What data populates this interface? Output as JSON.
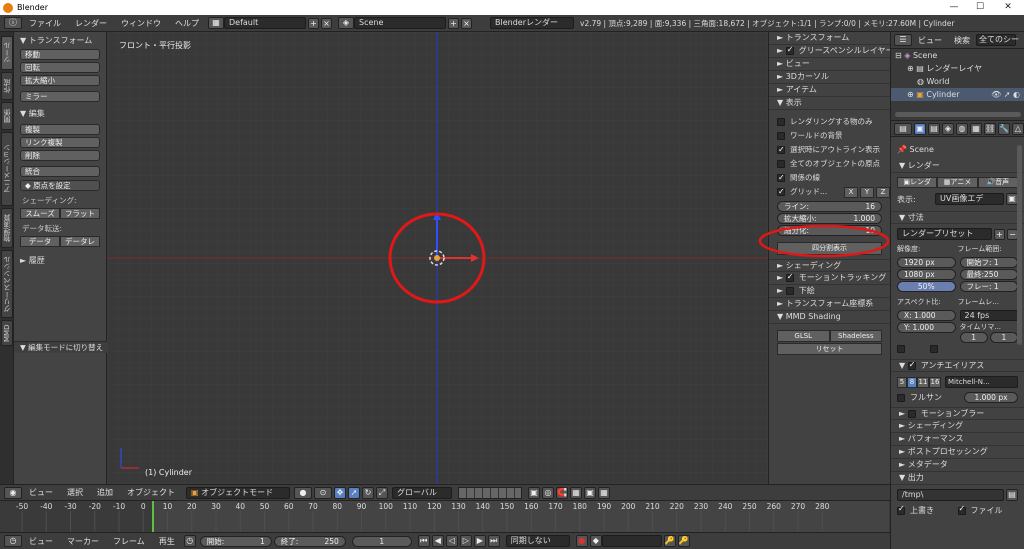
{
  "os_title": "Blender",
  "header": {
    "menus": [
      "ファイル",
      "レンダー",
      "ウィンドウ",
      "ヘルプ"
    ],
    "layout": "Default",
    "scene": "Scene",
    "engine": "Blenderレンダー",
    "stats": "v2.79 | 頂点:9,289 | 面:9,336 | 三角面:18,672 | オブジェクト:1/1 | ランプ:0/0 | メモリ:27.60M | Cylinder"
  },
  "left_tabs": [
    "ツール",
    "作成",
    "関係",
    "アニメーション",
    "物理演算",
    "グリースペンシル",
    "MMD"
  ],
  "toolshelf": {
    "transform_header": "トランスフォーム",
    "move": "移動",
    "rotate": "回転",
    "scale": "拡大縮小",
    "mirror": "ミラー",
    "edit_header": "編集",
    "duplicate": "複製",
    "link_duplicate": "リンク複製",
    "delete": "削除",
    "join": "統合",
    "set_origin": "原点を設定",
    "shading_label": "シェーディング:",
    "smooth": "スムーズ",
    "flat": "フラット",
    "data_transfer_label": "データ転送:",
    "data": "データ",
    "data_layer": "データレ",
    "history": "履歴",
    "edit_mode_toggle": "編集モードに切り替え"
  },
  "viewport": {
    "view_label": "フロント・平行投影",
    "object_label": "(1) Cylinder"
  },
  "npanel": {
    "transform": "トランスフォーム",
    "grease_pencil_layer": "グリースペンシルレイヤー",
    "view": "ビュー",
    "cursor3d": "3Dカーソル",
    "item": "アイテム",
    "display": "表示",
    "only_render": "レンダリングする物のみ",
    "world_bg": "ワールドの背景",
    "outline_selected": "選択時にアウトライン表示",
    "all_origins": "全てのオブジェクトの原点",
    "relationship_lines": "関係の線",
    "grid_floor": "グリッド...",
    "axis_x": "X",
    "axis_y": "Y",
    "axis_z": "Z",
    "lines_label": "ライン:",
    "lines_value": "16",
    "scale_label": "拡大縮小:",
    "scale_value": "1.000",
    "subdiv_label": "細分化:",
    "subdiv_value": "10",
    "quad_view": "四分割表示",
    "shading": "シェーディング",
    "motion_tracking": "モーショントラッキング",
    "background_images": "下絵",
    "transform_orientations": "トランスフォーム座標系",
    "mmd_shading": "MMD Shading",
    "glsl": "GLSL",
    "shadeless": "Shadeless",
    "reset": "リセット"
  },
  "outliner": {
    "view": "ビュー",
    "search": "検索",
    "filter": "全てのシー",
    "scene": "Scene",
    "render_layers": "レンダーレイヤ",
    "world": "World",
    "cylinder": "Cylinder"
  },
  "props": {
    "scene": "Scene",
    "render_header": "レンダー",
    "render_btn": "レンダ",
    "anim_btn": "アニメ",
    "audio_btn": "音声",
    "display_label": "表示:",
    "display_value": "UV画像エデ",
    "dimensions": "寸法",
    "render_presets": "レンダープリセット",
    "resolution_label": "解像度:",
    "res_x": "1920 px",
    "res_y": "1080 px",
    "res_pct": "50%",
    "frame_range_label": "フレーム範囲:",
    "frame_start": "開始フ: 1",
    "frame_end": "最終:250",
    "frame_step": "フレー: 1",
    "aspect_label": "アスペクト比:",
    "aspect_x": "X:  1.000",
    "aspect_y": "Y:  1.000",
    "framerate_label": "フレームレ...",
    "fps": "24 fps",
    "time_remap": "タイムリマ...",
    "remap_old": "1",
    "remap_new": "1",
    "antialiasing": "アンチエイリアス",
    "aa_5": "5",
    "aa_8": "8",
    "aa_11": "11",
    "aa_16": "16",
    "aa_filter": "Mitchell-N...",
    "full_sample": "フルサン",
    "filter_size": "1.000 px",
    "motion_blur": "モーションブラー",
    "shading": "シェーディング",
    "performance": "パフォーマンス",
    "post_processing": "ポストプロセッシング",
    "metadata": "メタデータ",
    "output": "出力",
    "output_path": "/tmp\\",
    "overwrite": "上書き",
    "file_ext": "ファイル"
  },
  "vpheader": {
    "view": "ビュー",
    "select": "選択",
    "add": "追加",
    "object": "オブジェクト",
    "mode": "オブジェクトモード",
    "orientation": "グローバル"
  },
  "timeline": {
    "ticks": [
      "-50",
      "-40",
      "-30",
      "-20",
      "-10",
      "0",
      "10",
      "20",
      "30",
      "40",
      "50",
      "60",
      "70",
      "80",
      "90",
      "100",
      "110",
      "120",
      "130",
      "140",
      "150",
      "160",
      "170",
      "180",
      "190",
      "200",
      "210",
      "220",
      "230",
      "240",
      "250",
      "260",
      "270",
      "280"
    ],
    "current_frame_marker": 1
  },
  "tlheader": {
    "view": "ビュー",
    "marker": "マーカー",
    "frame": "フレーム",
    "playback": "再生",
    "start_label": "開始:",
    "start_value": "1",
    "end_label": "終了:",
    "end_value": "250",
    "current": "1",
    "sync": "同期しない"
  }
}
